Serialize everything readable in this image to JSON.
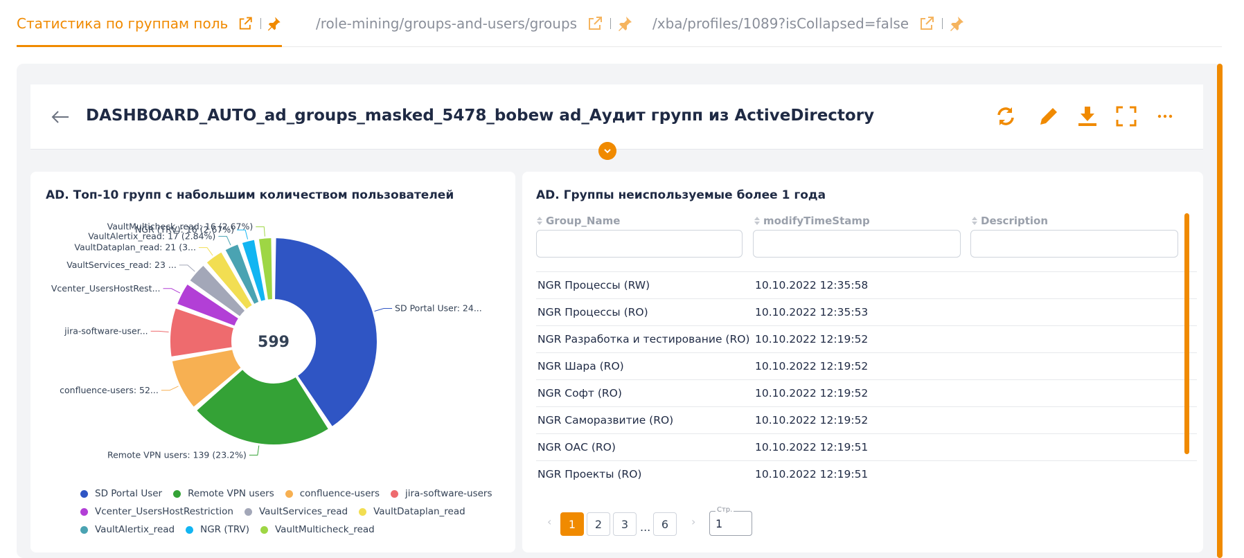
{
  "tabs": [
    {
      "label": "Статистика по группам поль...",
      "active": true
    },
    {
      "label": "/role-mining/groups-and-users/groups",
      "active": false
    },
    {
      "label": "/xba/profiles/1089?isCollapsed=false",
      "active": false
    }
  ],
  "header": {
    "title": "DASHBOARD_AUTO_ad_groups_masked_5478_bobew ad_Аудит групп из ActiveDirectory"
  },
  "icons": {
    "back": "arrow-left-icon",
    "refresh": "refresh-icon",
    "edit": "pencil-icon",
    "download": "download-icon",
    "fullscreen": "expand-icon",
    "more": "more-icon",
    "external": "external-link-icon",
    "pin": "pin-icon",
    "collapse": "chevron-down-icon"
  },
  "colors": {
    "accent": "#f08a00"
  },
  "chart_card": {
    "title": "AD. Топ-10 групп с набольшим количеством пользователей"
  },
  "chart_data": {
    "type": "pie",
    "center_label": "599",
    "slices": [
      {
        "name": "SD Portal User",
        "value": 247,
        "label": "SD Portal User: 24...",
        "color": "#2f55c4"
      },
      {
        "name": "Remote VPN users",
        "value": 139,
        "label": "Remote VPN users: 139 (23.2%)",
        "color": "#34a236"
      },
      {
        "name": "confluence-users",
        "value": 52,
        "label": "confluence-users: 52...",
        "color": "#f7b052"
      },
      {
        "name": "jira-software-users",
        "value": 50,
        "label": "jira-software-user...",
        "color": "#ee6b6e"
      },
      {
        "name": "Vcenter_UsersHostRestriction",
        "value": 25,
        "label": "Vcenter_UsersHostRest...",
        "color": "#b23fd6"
      },
      {
        "name": "VaultServices_read",
        "value": 23,
        "label": "VaultServices_read: 23 ...",
        "color": "#a3a7b8"
      },
      {
        "name": "VaultDataplan_read",
        "value": 21,
        "label": "VaultDataplan_read: 21 (3...",
        "color": "#f2de52"
      },
      {
        "name": "VaultAlertix_read",
        "value": 17,
        "label": "VaultAlertix_read: 17 (2.84%)",
        "color": "#4aa3b2"
      },
      {
        "name": "NGR (TRV)",
        "value": 16,
        "label": "NGR (TRV): 16 (2.67%)",
        "color": "#12b5f2"
      },
      {
        "name": "VaultMulticheck_read",
        "value": 16,
        "label": "VaultMulticheck_read: 16 (2.67%)",
        "color": "#9ed644"
      }
    ],
    "legend": [
      [
        "SD Portal User",
        "Remote VPN users",
        "confluence-users",
        "jira-software-users"
      ],
      [
        "Vcenter_UsersHostRestriction",
        "VaultServices_read",
        "VaultDataplan_read"
      ],
      [
        "VaultAlertix_read",
        "NGR (TRV)",
        "VaultMulticheck_read"
      ]
    ]
  },
  "table_card": {
    "title": "AD. Группы неиспользуемые более 1 года",
    "columns": [
      "Group_Name",
      "modifyTimeStamp",
      "Description"
    ],
    "rows": [
      [
        "NGR Процессы (RW)",
        "10.10.2022 12:35:58"
      ],
      [
        "NGR Процессы (RO)",
        "10.10.2022 12:35:53"
      ],
      [
        "NGR Разработка и тестирование (RO)",
        "10.10.2022 12:19:52"
      ],
      [
        "NGR Шара (RO)",
        "10.10.2022 12:19:52"
      ],
      [
        "NGR Софт (RO)",
        "10.10.2022 12:19:52"
      ],
      [
        "NGR Саморазвитие (RO)",
        "10.10.2022 12:19:52"
      ],
      [
        "NGR ОАС (RO)",
        "10.10.2022 12:19:51"
      ],
      [
        "NGR Проекты (RO)",
        "10.10.2022 12:19:51"
      ]
    ]
  },
  "pagination": {
    "prev": "‹",
    "next": "›",
    "pages": [
      "1",
      "2",
      "3"
    ],
    "ellipsis": "...",
    "last": "6",
    "current": "1",
    "input_label": "Стр.",
    "input_value": "1"
  }
}
